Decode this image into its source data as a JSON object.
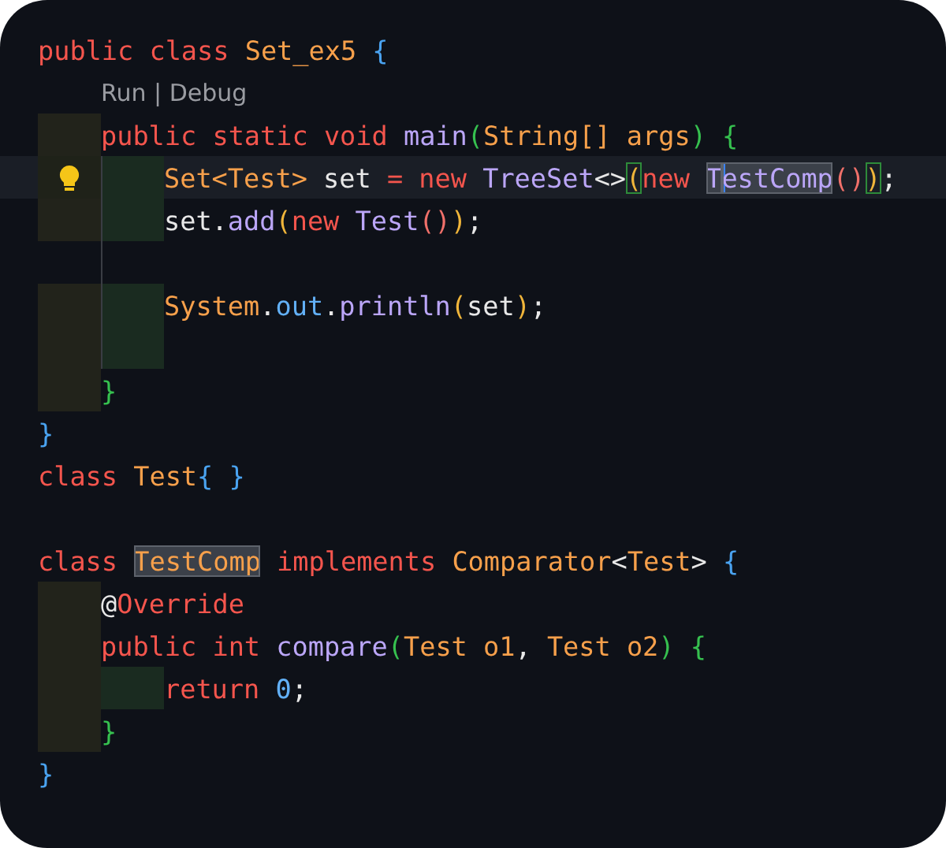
{
  "lines": [
    {
      "kind": "code",
      "tokens": [
        {
          "text": "public class ",
          "kind": "keyword"
        },
        {
          "text": "Set_ex5 ",
          "kind": "type"
        },
        {
          "text": "{",
          "kind": "bracket1"
        }
      ]
    },
    {
      "kind": "codelens",
      "text": "Run | Debug"
    },
    {
      "kind": "code",
      "indent": [
        {
          "shaded": true
        }
      ],
      "tokens": [
        {
          "text": "public static void ",
          "kind": "keyword"
        },
        {
          "text": "main",
          "kind": "method"
        },
        {
          "text": "(",
          "kind": "bracket2"
        },
        {
          "text": "String[] args",
          "kind": "type"
        },
        {
          "text": ") {",
          "kind": "bracket2"
        }
      ]
    },
    {
      "kind": "code",
      "indent": [
        {
          "shaded": true
        },
        {
          "shaded": true
        }
      ],
      "current": true,
      "bulb": true,
      "guide": true,
      "tokens": [
        {
          "text": "Set<Test> ",
          "kind": "type"
        },
        {
          "text": "set ",
          "kind": "plain"
        },
        {
          "text": "= new ",
          "kind": "keyword"
        },
        {
          "text": "TreeSet",
          "kind": "method"
        },
        {
          "text": "<>",
          "kind": "plain"
        },
        {
          "text": "(",
          "kind": "bracket3",
          "highlighted": true
        },
        {
          "text": "new ",
          "kind": "keyword"
        },
        {
          "text": "T",
          "kind": "method",
          "highlighted": true
        },
        {
          "text": "estComp",
          "kind": "method",
          "highlighted": true,
          "cursor": true
        },
        {
          "text": "()",
          "kind": "bracket4"
        },
        {
          "text": ")",
          "kind": "bracket3",
          "highlighted": true
        },
        {
          "text": ";",
          "kind": "plain"
        }
      ]
    },
    {
      "kind": "code",
      "indent": [
        {
          "shaded": true
        },
        {
          "shaded": true
        }
      ],
      "guide": true,
      "tokens": [
        {
          "text": "set.",
          "kind": "plain"
        },
        {
          "text": "add",
          "kind": "method"
        },
        {
          "text": "(",
          "kind": "bracket3"
        },
        {
          "text": "new ",
          "kind": "keyword"
        },
        {
          "text": "Test",
          "kind": "method"
        },
        {
          "text": "()",
          "kind": "bracket4"
        },
        {
          "text": ")",
          "kind": "bracket3"
        },
        {
          "text": ";",
          "kind": "plain"
        }
      ]
    },
    {
      "kind": "code",
      "guide": true
    },
    {
      "kind": "code",
      "indent": [
        {
          "shaded": true
        },
        {
          "shaded": true
        }
      ],
      "guide": true,
      "tokens": [
        {
          "text": "System",
          "kind": "type"
        },
        {
          "text": ".",
          "kind": "plain"
        },
        {
          "text": "out",
          "kind": "field"
        },
        {
          "text": ".",
          "kind": "plain"
        },
        {
          "text": "println",
          "kind": "method"
        },
        {
          "text": "(",
          "kind": "bracket3"
        },
        {
          "text": "set",
          "kind": "plain"
        },
        {
          "text": ")",
          "kind": "bracket3"
        },
        {
          "text": ";",
          "kind": "plain"
        }
      ]
    },
    {
      "kind": "code",
      "indent": [
        {
          "shaded": true
        },
        {
          "shaded": true
        }
      ],
      "guide": true
    },
    {
      "kind": "code",
      "indent": [
        {
          "shaded": true
        }
      ],
      "tokens": [
        {
          "text": "}",
          "kind": "bracket2"
        }
      ]
    },
    {
      "kind": "code",
      "tokens": [
        {
          "text": "}",
          "kind": "bracket1"
        }
      ]
    },
    {
      "kind": "code",
      "tokens": [
        {
          "text": "class ",
          "kind": "keyword"
        },
        {
          "text": "Test",
          "kind": "type"
        },
        {
          "text": "{ }",
          "kind": "bracket1"
        }
      ]
    },
    {
      "kind": "code"
    },
    {
      "kind": "code",
      "tokens": [
        {
          "text": "class ",
          "kind": "keyword"
        },
        {
          "text": "TestComp",
          "kind": "type",
          "highlighted": true
        },
        {
          "text": " implements ",
          "kind": "keyword"
        },
        {
          "text": "Comparator",
          "kind": "type"
        },
        {
          "text": "<",
          "kind": "plain"
        },
        {
          "text": "Test",
          "kind": "type"
        },
        {
          "text": "> ",
          "kind": "plain"
        },
        {
          "text": "{",
          "kind": "bracket1"
        }
      ]
    },
    {
      "kind": "code",
      "indent": [
        {
          "shaded": true
        }
      ],
      "tokens": [
        {
          "text": "@",
          "kind": "plain"
        },
        {
          "text": "Override",
          "kind": "keyword"
        }
      ]
    },
    {
      "kind": "code",
      "indent": [
        {
          "shaded": true
        }
      ],
      "tokens": [
        {
          "text": "public int ",
          "kind": "keyword"
        },
        {
          "text": "compare",
          "kind": "method"
        },
        {
          "text": "(",
          "kind": "bracket2"
        },
        {
          "text": "Test o1",
          "kind": "type"
        },
        {
          "text": ", ",
          "kind": "plain"
        },
        {
          "text": "Test o2",
          "kind": "type"
        },
        {
          "text": ") {",
          "kind": "bracket2"
        }
      ]
    },
    {
      "kind": "code",
      "indent": [
        {
          "shaded": true
        },
        {
          "shaded": true
        }
      ],
      "tokens": [
        {
          "text": "return ",
          "kind": "keyword"
        },
        {
          "text": "0",
          "kind": "number"
        },
        {
          "text": ";",
          "kind": "plain"
        }
      ]
    },
    {
      "kind": "code",
      "indent": [
        {
          "shaded": true
        }
      ],
      "tokens": [
        {
          "text": "}",
          "kind": "bracket2"
        }
      ]
    },
    {
      "kind": "code",
      "tokens": [
        {
          "text": "}",
          "kind": "bracket1"
        }
      ]
    }
  ]
}
